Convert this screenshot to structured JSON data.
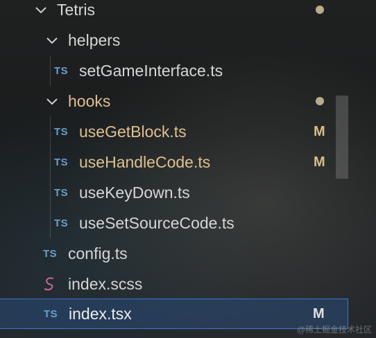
{
  "tree": {
    "root": {
      "label": "Tetris",
      "expanded": true,
      "dot": true
    },
    "helpers": {
      "label": "helpers",
      "expanded": true
    },
    "setGameInterface": {
      "icon": "TS",
      "label": "setGameInterface.ts"
    },
    "hooks": {
      "label": "hooks",
      "expanded": true,
      "dot": true
    },
    "useGetBlock": {
      "icon": "TS",
      "label": "useGetBlock.ts",
      "status": "M"
    },
    "useHandleCode": {
      "icon": "TS",
      "label": "useHandleCode.ts",
      "status": "M"
    },
    "useKeyDown": {
      "icon": "TS",
      "label": "useKeyDown.ts"
    },
    "useSetSourceCode": {
      "icon": "TS",
      "label": "useSetSourceCode.ts"
    },
    "config": {
      "icon": "TS",
      "label": "config.ts"
    },
    "indexScss": {
      "icon": "sass-icon",
      "label": "index.scss"
    },
    "indexTsx": {
      "icon": "TS",
      "label": "index.tsx",
      "status": "M",
      "selected": true
    }
  },
  "colors": {
    "modified": "#e0c08d",
    "ts_icon": "#6b9fcb",
    "selection_border": "#3a78c4",
    "sass_icon": "#cd6799"
  },
  "watermark": "@稀土掘金技术社区"
}
